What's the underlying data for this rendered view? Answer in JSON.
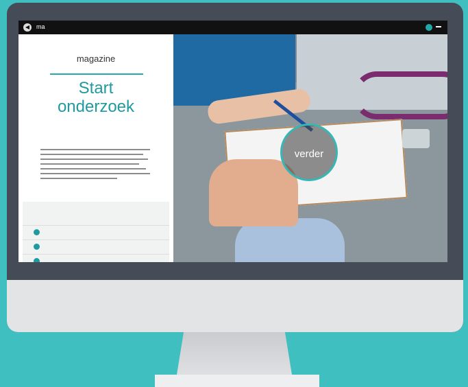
{
  "topbar": {
    "title": "ma"
  },
  "magazine": {
    "kicker": "magazine",
    "title_line1": "Start",
    "title_line2": "onderzoek"
  },
  "cta": {
    "label": "verder"
  },
  "list": {
    "items": [
      {
        "meta": ""
      },
      {
        "meta": ""
      },
      {
        "meta": ""
      }
    ]
  },
  "colors": {
    "background": "#3fbfc0",
    "accent": "#1f9aa0",
    "bezel": "#454c57"
  }
}
